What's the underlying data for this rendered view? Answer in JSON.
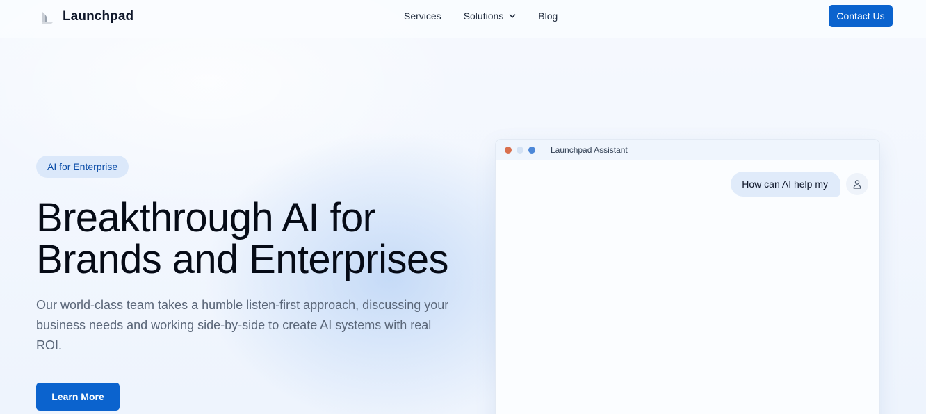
{
  "header": {
    "brand": "Launchpad",
    "nav": [
      {
        "label": "Services"
      },
      {
        "label": "Solutions",
        "has_dropdown": true
      },
      {
        "label": "Blog"
      }
    ],
    "contact_label": "Contact Us"
  },
  "hero": {
    "badge": "AI for Enterprise",
    "headline_line1": "Breakthrough AI for",
    "headline_line2": "Brands and Enterprises",
    "description": "Our world-class team takes a humble listen-first approach, discussing your business needs and working side-by-side to create AI systems with real ROI.",
    "cta_label": "Learn More"
  },
  "assistant": {
    "title": "Launchpad Assistant",
    "user_message": "How can AI help my"
  },
  "colors": {
    "accent": "#0b63ce",
    "badge_bg": "#dbe8fa",
    "bubble_bg": "#e0ebfa"
  },
  "icons": {
    "logo": "launchpad-logo-icon",
    "dropdown": "chevron-down-icon",
    "user": "user-icon"
  }
}
